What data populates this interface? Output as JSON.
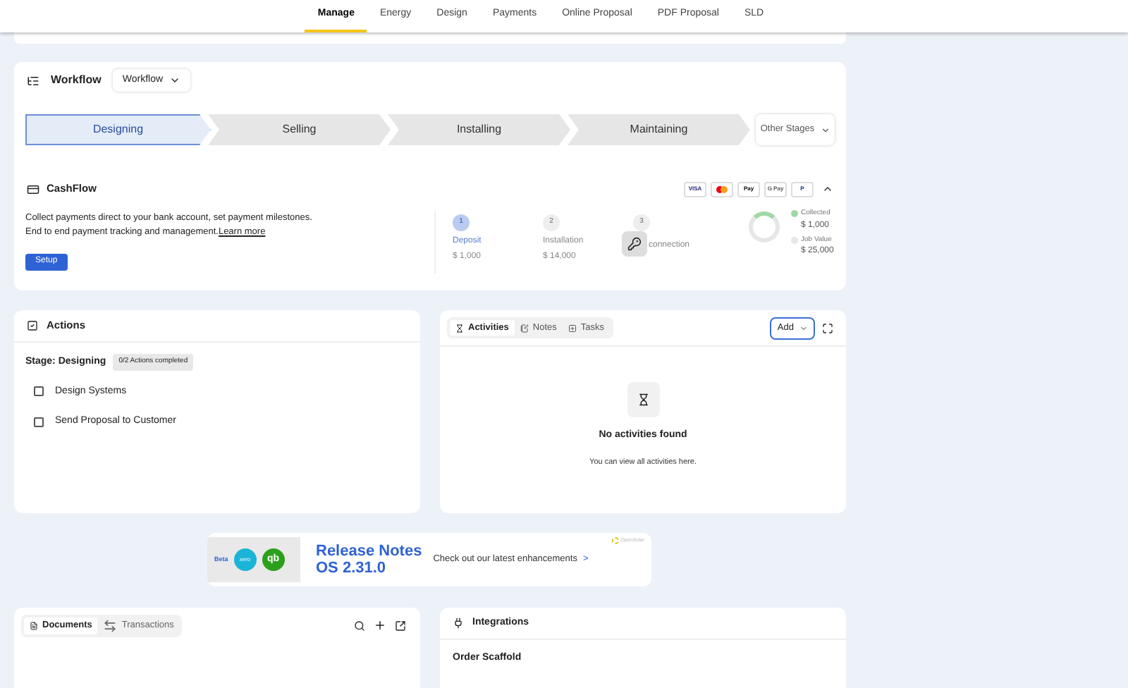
{
  "nav_tabs": [
    {
      "label": "Manage",
      "selected": true
    },
    {
      "label": "Energy",
      "selected": false
    },
    {
      "label": "Design",
      "selected": false
    },
    {
      "label": "Payments",
      "selected": false
    },
    {
      "label": "Online Proposal",
      "selected": false
    },
    {
      "label": "PDF Proposal",
      "selected": false
    },
    {
      "label": "SLD",
      "selected": false
    }
  ],
  "workflow": {
    "title": "Workflow",
    "dropdown": "Workflow",
    "stages": [
      {
        "label": "Designing",
        "selected": true
      },
      {
        "label": "Selling",
        "selected": false
      },
      {
        "label": "Installing",
        "selected": false
      },
      {
        "label": "Maintaining",
        "selected": false
      }
    ],
    "other_stages": "Other Stages"
  },
  "cashflow": {
    "title": "CashFlow",
    "payment_methods": [
      {
        "kind": "text",
        "label": "VISA"
      },
      {
        "kind": "mastercard"
      },
      {
        "kind": "text",
        "label": "Pay"
      },
      {
        "kind": "text",
        "label": "G Pay"
      },
      {
        "kind": "text",
        "label": "P"
      }
    ],
    "description_1": "Collect payments direct to your bank account, set payment milestones.",
    "description_2": "End to end payment tracking and management.",
    "learn_more": "Learn more",
    "setup_button": "Setup",
    "milestones": [
      {
        "number": "1",
        "label": "Deposit",
        "amount": "$ 1,000",
        "selected": true
      },
      {
        "number": "2",
        "label": "Installation",
        "amount": "$ 14,000",
        "selected": false
      },
      {
        "number": "3",
        "label": "connection",
        "selected": false
      }
    ],
    "legend": [
      {
        "label": "Collected",
        "value": "$ 1,000",
        "color": "#9fd8a6"
      },
      {
        "label": "Job Value",
        "value": "$ 25,000",
        "color": "#e5e7eb"
      }
    ]
  },
  "actions": {
    "title": "Actions",
    "stage": "Stage: Designing",
    "progress": "0/2 Actions completed",
    "items": [
      {
        "label": "Design Systems",
        "checked": false
      },
      {
        "label": "Send Proposal to Customer",
        "checked": false
      }
    ]
  },
  "activities": {
    "tabs": [
      {
        "label": "Activities",
        "selected": true
      },
      {
        "label": "Notes",
        "selected": false
      },
      {
        "label": "Tasks",
        "selected": false
      }
    ],
    "add_button": "Add",
    "empty_title": "No activities found",
    "empty_text": "You can view all activities here."
  },
  "banner": {
    "beta": "Beta",
    "xero": "xero",
    "qb": "qb",
    "title_1": "Release Notes",
    "title_2": "OS 2.31.0",
    "text": "Check out our latest enhancements",
    "arrow": ">",
    "brand": "OpenSolar"
  },
  "documents": {
    "tabs": [
      {
        "label": "Documents",
        "selected": true
      },
      {
        "label": "Transactions",
        "selected": false
      }
    ]
  },
  "integrations": {
    "title": "Integrations",
    "subtitle": "Order Scaffold"
  }
}
